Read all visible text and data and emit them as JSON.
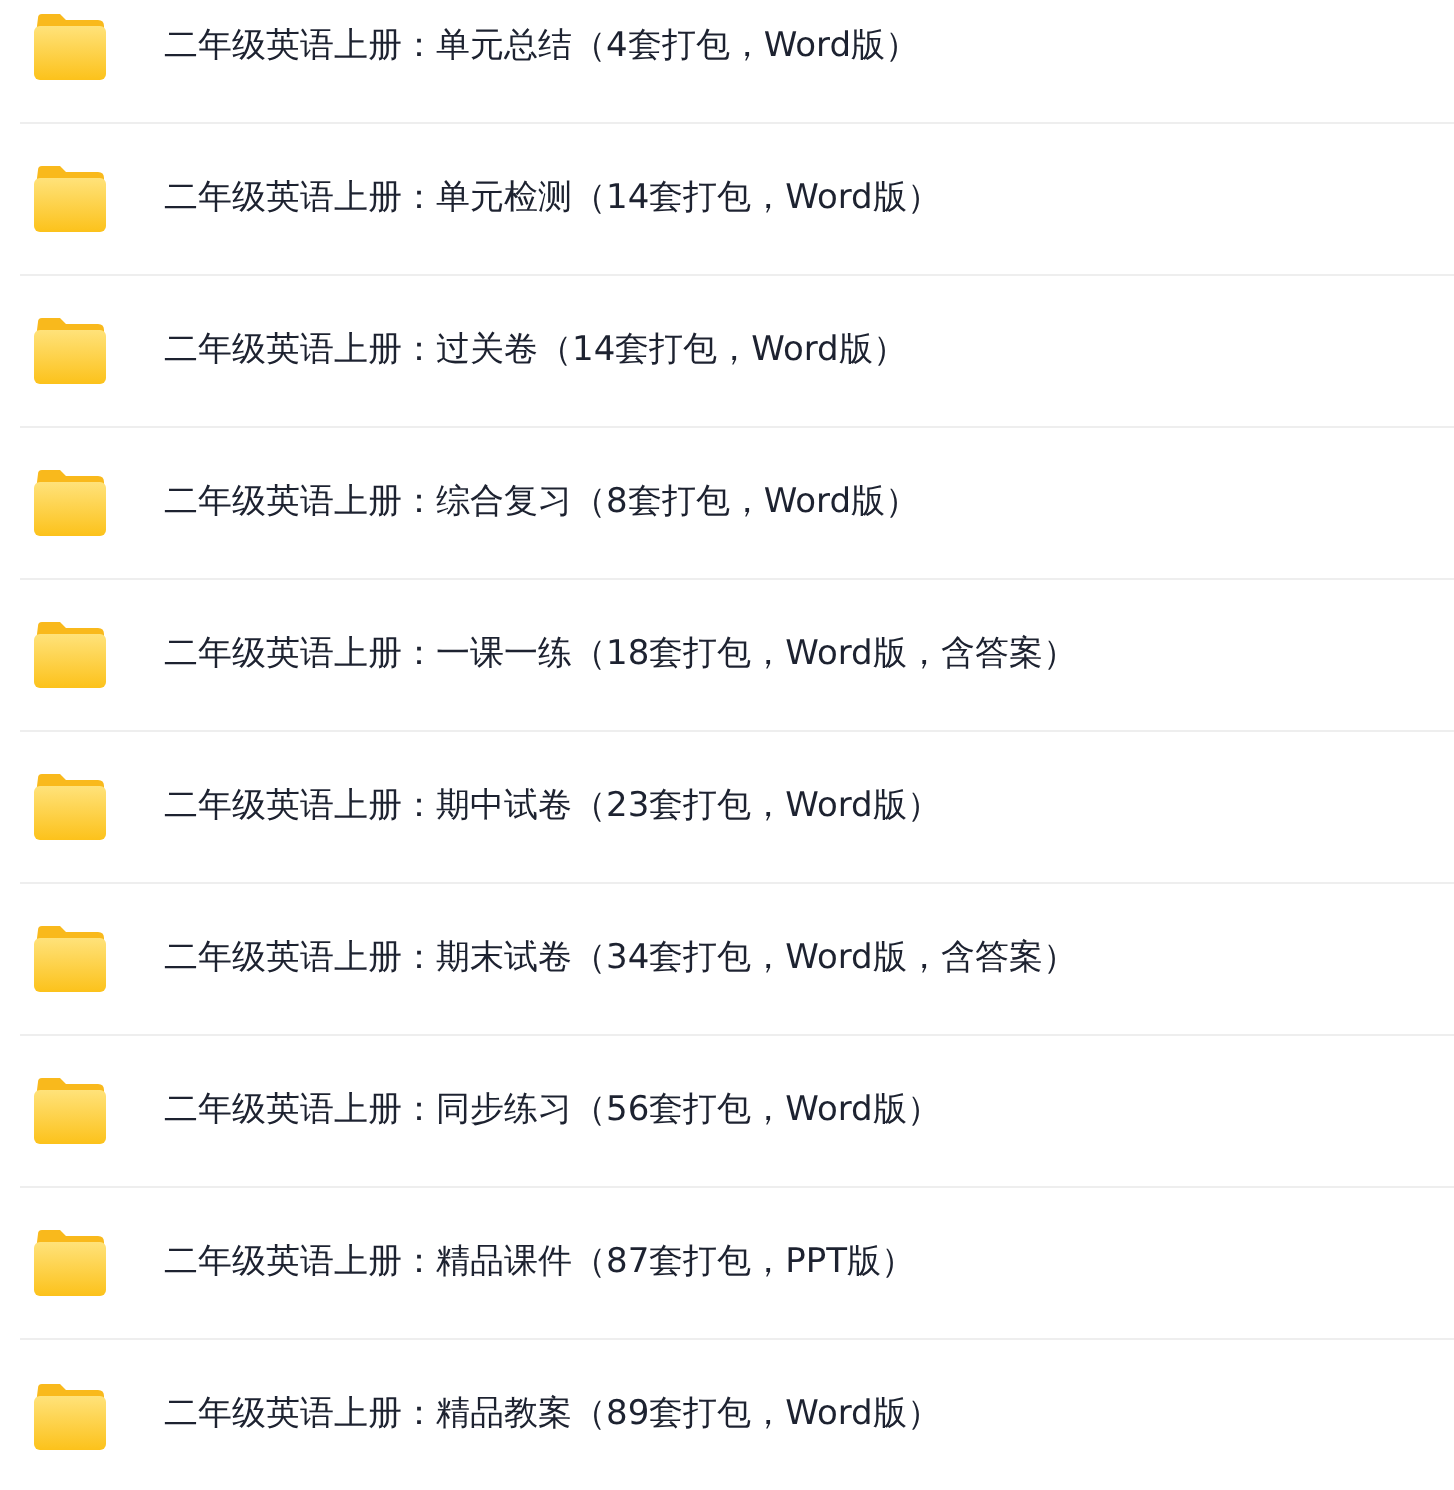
{
  "files": [
    {
      "name": "二年级英语上册：单元总结（4套打包，Word版）"
    },
    {
      "name": "二年级英语上册：单元检测（14套打包，Word版）"
    },
    {
      "name": "二年级英语上册：过关卷（14套打包，Word版）"
    },
    {
      "name": "二年级英语上册：综合复习（8套打包，Word版）"
    },
    {
      "name": "二年级英语上册：一课一练（18套打包，Word版，含答案）"
    },
    {
      "name": "二年级英语上册：期中试卷（23套打包，Word版）"
    },
    {
      "name": "二年级英语上册：期末试卷（34套打包，Word版，含答案）"
    },
    {
      "name": "二年级英语上册：同步练习（56套打包，Word版）"
    },
    {
      "name": "二年级英语上册：精品课件（87套打包，PPT版）"
    },
    {
      "name": "二年级英语上册：精品教案（89套打包，Word版）"
    }
  ]
}
